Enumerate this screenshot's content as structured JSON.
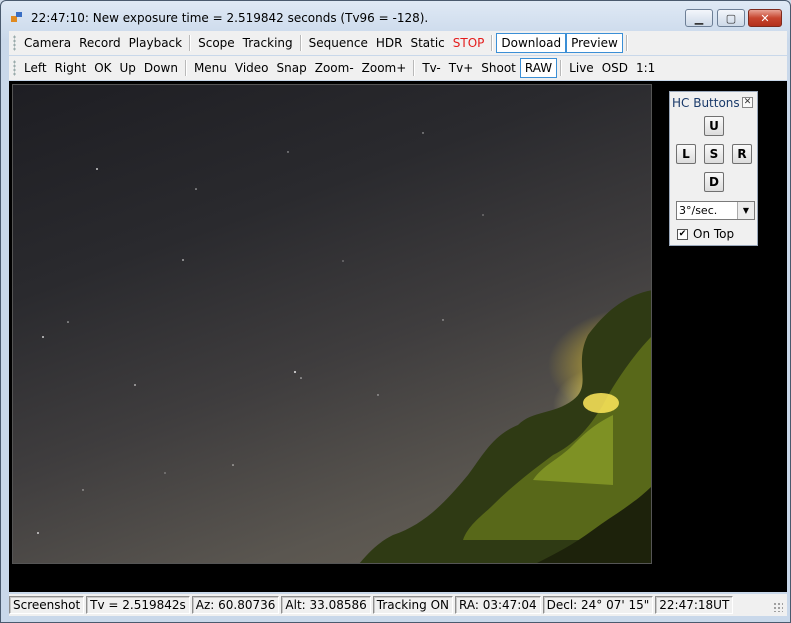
{
  "window": {
    "title": "22:47:10: New exposure time = 2.519842 seconds (Tv96 = -128)."
  },
  "toolbar1": {
    "group1": [
      "Camera",
      "Record",
      "Playback"
    ],
    "group2": [
      "Scope",
      "Tracking"
    ],
    "group3": [
      "Sequence",
      "HDR",
      "Static",
      "STOP"
    ],
    "group4": [
      "Download",
      "Preview"
    ]
  },
  "toolbar2": {
    "group1": [
      "Left",
      "Right",
      "OK",
      "Up",
      "Down"
    ],
    "group2": [
      "Menu",
      "Video",
      "Snap",
      "Zoom-",
      "Zoom+"
    ],
    "group3": [
      "Tv-",
      "Tv+",
      "Shoot",
      "RAW"
    ],
    "group4": [
      "Live",
      "OSD",
      "1:1"
    ]
  },
  "hc": {
    "title": "HC Buttons",
    "up": "U",
    "left": "L",
    "stop": "S",
    "right": "R",
    "down": "D",
    "rate": "3°/sec.",
    "on_top_label": "On Top",
    "on_top_checked": true
  },
  "status": {
    "screenshot": "Screenshot",
    "tv": "Tv = 2.519842s",
    "az": "Az: 60.80736",
    "alt": "Alt: 33.08586",
    "tracking": "Tracking ON",
    "ra": "RA: 03:47:04",
    "decl": "Decl: 24° 07' 15\"",
    "time": "22:47:18UT"
  },
  "colors": {
    "stop": "#e41c1c",
    "accent": "#3b8fd6",
    "viewport": "#000000"
  }
}
